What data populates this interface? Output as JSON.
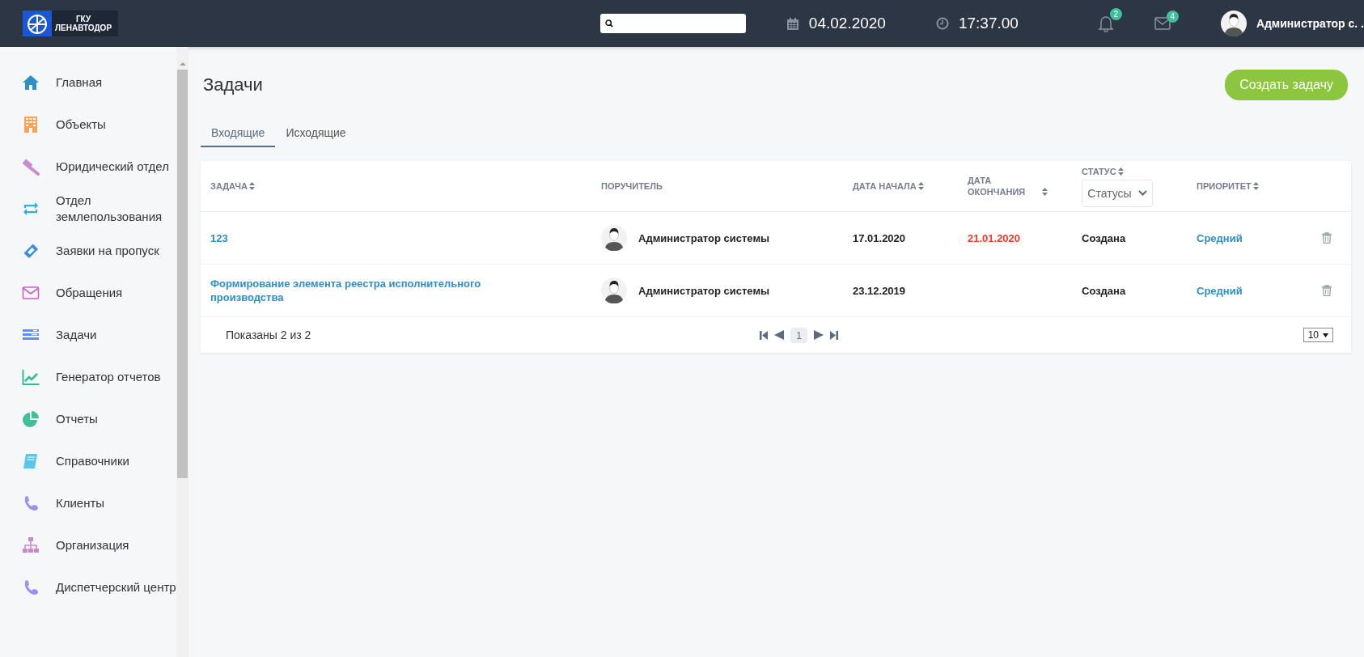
{
  "header": {
    "logo": {
      "line_1": "ГКУ",
      "line_2": "ЛЕНАВТОДОР"
    },
    "date": "04.02.2020",
    "time": "17:37.00",
    "notifications": {
      "count": "2"
    },
    "messages": {
      "count": "4"
    },
    "user": {
      "name": "Администратор с. ."
    }
  },
  "sidebar": {
    "items": [
      {
        "label": "Главная"
      },
      {
        "label": "Объекты"
      },
      {
        "label": "Юридический отдел"
      },
      {
        "label": "Отдел землепользования"
      },
      {
        "label": "Заявки на пропуск"
      },
      {
        "label": "Обращения"
      },
      {
        "label": "Задачи"
      },
      {
        "label": "Генератор отчетов"
      },
      {
        "label": "Отчеты"
      },
      {
        "label": "Справочники"
      },
      {
        "label": "Клиенты"
      },
      {
        "label": "Организация"
      },
      {
        "label": "Диспетчерский центр"
      }
    ]
  },
  "page": {
    "title": "Задачи",
    "create_button": "Создать задачу"
  },
  "tabs": [
    {
      "label": "Входящие",
      "selected": true
    },
    {
      "label": "Исходящие",
      "selected": false
    }
  ],
  "table": {
    "columns": [
      {
        "label": "ЗАДАЧА",
        "sortable": true
      },
      {
        "label": "ПОРУЧИТЕЛЬ",
        "sortable": false
      },
      {
        "label": "ДАТА НАЧАЛА",
        "sortable": true
      },
      {
        "label": "ДАТА ОКОНЧАНИЯ",
        "sortable": true
      },
      {
        "label": "СТАТУС",
        "sortable": true,
        "filter": "Статусы"
      },
      {
        "label": "ПРИОРИТЕТ",
        "sortable": true
      }
    ],
    "rows": [
      {
        "task": "123",
        "assigner": "Администратор системы",
        "start": "17.01.2020",
        "end": "21.01.2020",
        "overdue": true,
        "status": "Создана",
        "priority": "Средний"
      },
      {
        "task": "Формирование элемента реестра исполнительного производства",
        "assigner": "Администратор системы",
        "start": "23.12.2019",
        "status": "Создана",
        "priority": "Средний"
      }
    ],
    "summary": "Показаны 2 из 2",
    "pages": [
      {
        "label": "1",
        "selected": true
      }
    ],
    "page_size": "10"
  }
}
